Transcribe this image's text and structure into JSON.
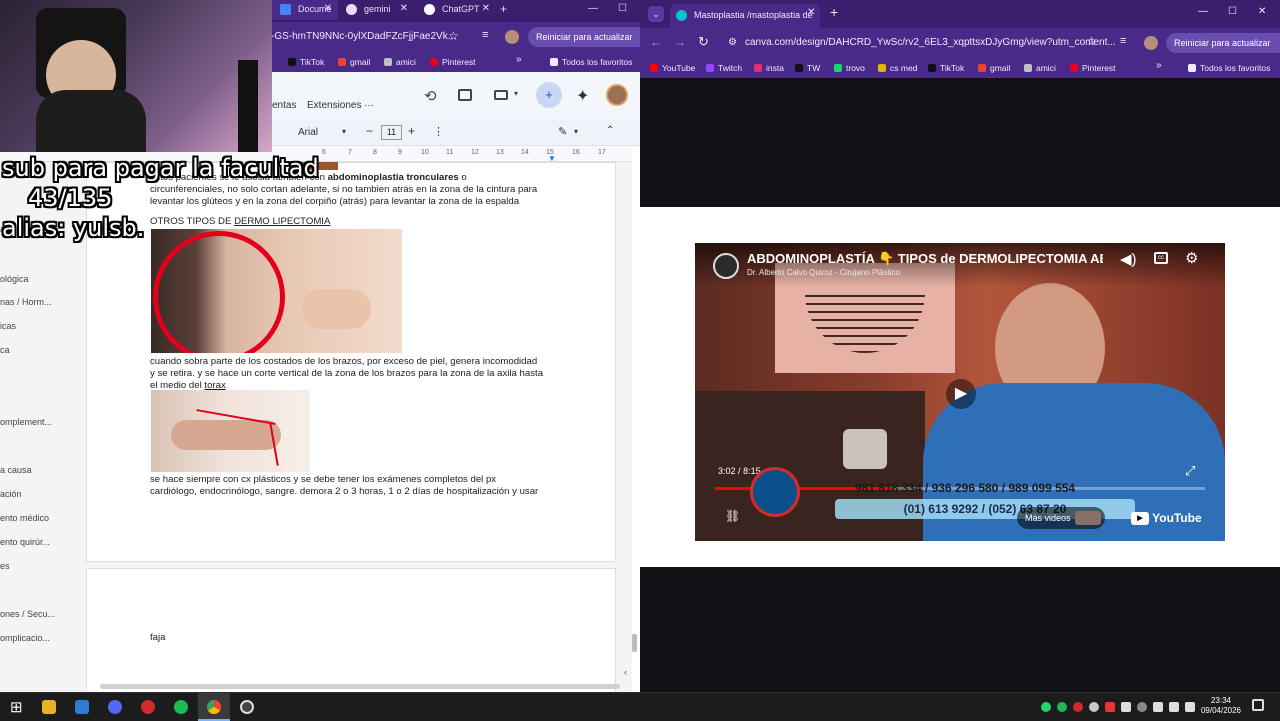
{
  "left_browser": {
    "tabs": [
      {
        "label": "Docume",
        "active": true
      },
      {
        "label": "gemini"
      },
      {
        "label": "ChatGPT"
      }
    ],
    "url": "x-GS-hmTN9NNc-0ylXDadFZcFjjFae2Vk...",
    "restart_label": "Reiniciar para actualizar",
    "bookmarks": [
      "TikTok",
      "gmail",
      "amici",
      "Pinterest"
    ],
    "all_favorites": "Todos los favoritos"
  },
  "docs": {
    "menu_partial": "entas",
    "menu_extensions": "Extensiones",
    "font": "Arial",
    "font_size": "11",
    "ruler_numbers": [
      "6",
      "7",
      "8",
      "9",
      "10",
      "11",
      "12",
      "13",
      "14",
      "15",
      "16",
      "17",
      "18"
    ],
    "outline": [
      "a",
      "ológica",
      "nas / Horm...",
      "icas",
      "ca",
      "omplement...",
      "a causa",
      "ación",
      "ento médico",
      "ento quirúr...",
      "es",
      "ones / Secu...",
      "omplicacio..."
    ],
    "paragraph1_line1_pre": "estos pacientes se le asocia también con ",
    "paragraph1_line1_bold": "abdominoplastia tronculares",
    "paragraph1_line1_post": " o",
    "paragraph1_line2": "circunferenciales, no solo cortan adelante, si no tambien atrás en la zona de la cintura para",
    "paragraph1_line3": "levantar los glúteos y en la zona del corpiño (atrás) para levantar la zona de la espalda",
    "heading_pre": "OTROS TIPOS DE ",
    "heading_link": "DERMO LIPECTOMIA",
    "paragraph2_line1": "cuando sobra parte de los costados de los brazos, por exceso de piel, genera incomodidad",
    "paragraph2_line2": "y se retira. y se hace un corte vertical de la zona de los brazos para la zona de la axila hasta",
    "paragraph2_line3_pre": "el medio del ",
    "paragraph2_line3_link": "torax",
    "paragraph3_line1": "se hace siempre con cx plásticos y se debe tener los exámenes completos del px",
    "paragraph3_line2": "cardiólogo, endocrinólogo, sangre. demora 2 o 3 horas, 1 o 2 días de hospitalización y usar",
    "page2_text": "faja"
  },
  "stream_overlay": {
    "line1": "sub para pagar la facultad",
    "line2": "43/135",
    "line3": "alias: yulsb."
  },
  "right_browser": {
    "tab_label": "Mastoplastia /mastoplastia de",
    "url": "canva.com/design/DAHCRD_YwSc/rv2_6EL3_xqpttsxDJyGmg/view?utm_content...",
    "restart_label": "Reiniciar para actualizar",
    "bookmarks": [
      "YouTube",
      "Twitch",
      "insta",
      "TW",
      "trovo",
      "cs med",
      "TikTok",
      "gmail",
      "amici",
      "Pinterest"
    ],
    "all_favorites": "Todos los favoritos"
  },
  "video": {
    "title": "ABDOMINOPLASTÍA 👇 TIPOS de DERMOLIPECTOMIA ABDO",
    "channel": "Dr. Alberto Calvo Quiroz - Cirujano Plástico",
    "time_current": "3:02",
    "time_separator": "/",
    "time_total": "8:15",
    "progress_fraction": 0.366,
    "phone1": "981 818 334 / 936 296 580 / 989 099 554",
    "phone2": "(01) 613 9292 / (052) 63 87 20",
    "more_videos": "Más videos",
    "youtube_label": "YouTube"
  },
  "taskbar": {
    "time": "23:34",
    "date": "09/04/2026"
  },
  "colors": {
    "chrome_purple": "#4a2a88",
    "tab_purple": "#3b1e6e",
    "youtube_red": "#ff0000"
  }
}
